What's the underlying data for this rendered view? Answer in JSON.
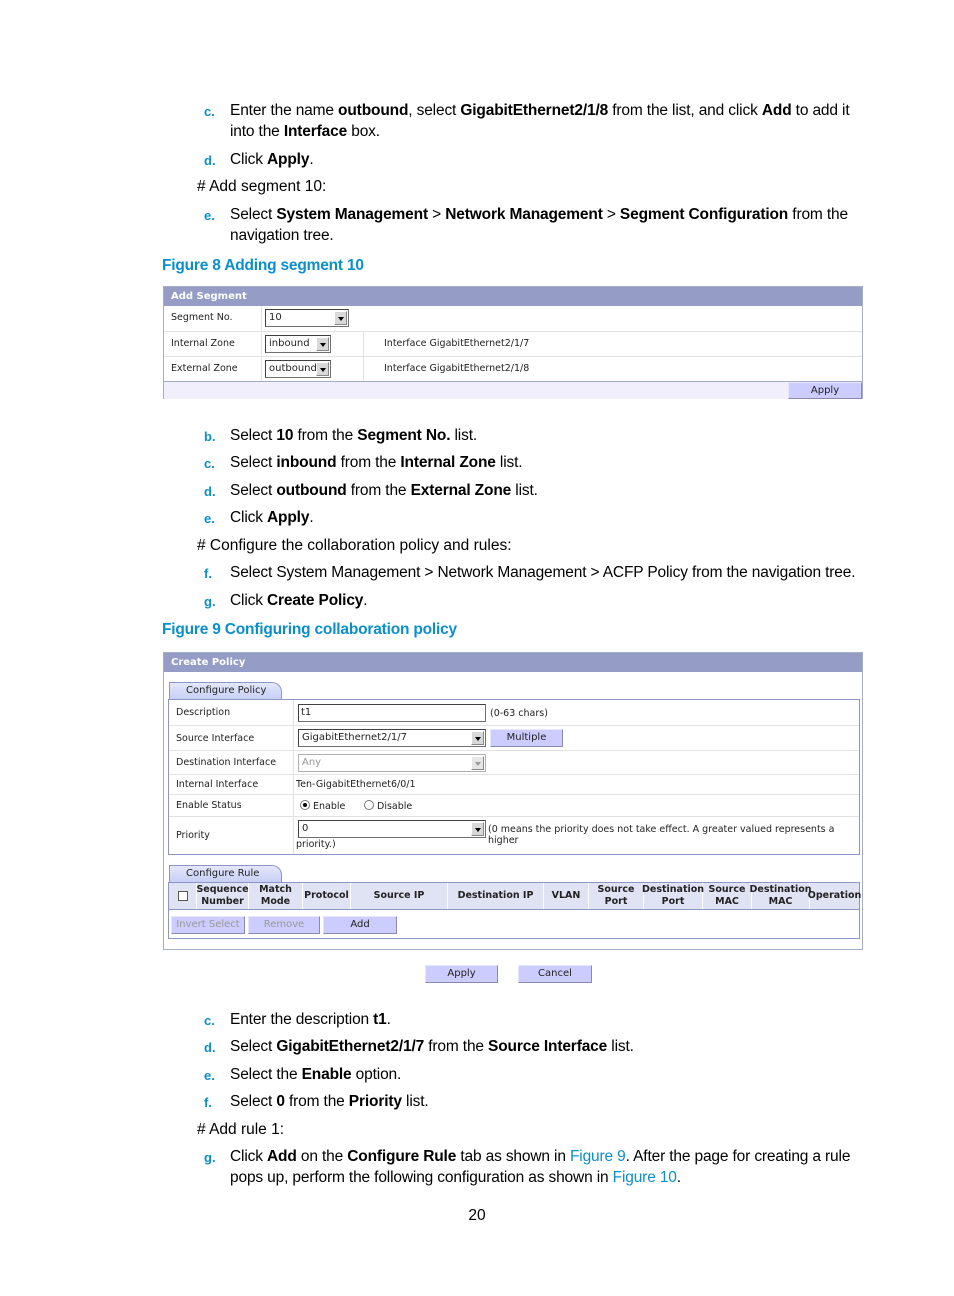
{
  "doc": {
    "step_c1": {
      "letter": "c.",
      "parts": [
        "Enter the name ",
        "outbound",
        ", select ",
        "GigabitEthernet2/1/8",
        " from the list, and click ",
        "Add",
        " to add it",
        "into the ",
        "Interface",
        " box."
      ]
    },
    "step_d1": {
      "letter": "d.",
      "parts": [
        "Click ",
        "Apply",
        "."
      ]
    },
    "note_segment": "# Add segment 10:",
    "step_e1": {
      "letter": "e.",
      "parts": [
        "Select ",
        "System Management",
        " > ",
        "Network Management",
        " > ",
        "Segment Configuration",
        " from the",
        "navigation tree."
      ]
    },
    "figure8_caption": "Figure 8 Adding segment 10",
    "step_b2": {
      "letter": "b.",
      "parts": [
        "Select ",
        "10",
        " from the ",
        "Segment No.",
        " list."
      ]
    },
    "step_c2": {
      "letter": "c.",
      "parts": [
        "Select ",
        "inbound",
        " from the ",
        "Internal Zone",
        " list."
      ]
    },
    "step_d2": {
      "letter": "d.",
      "parts": [
        "Select ",
        "outbound",
        " from the ",
        "External Zone",
        " list."
      ]
    },
    "step_e2": {
      "letter": "e.",
      "parts": [
        "Click ",
        "Apply",
        "."
      ]
    },
    "note_policy": "# Configure the collaboration policy and rules:",
    "step_f2": {
      "letter": "f.",
      "text": "Select System Management > Network Management > ACFP Policy from the navigation tree."
    },
    "step_g2": {
      "letter": "g.",
      "parts": [
        "Click ",
        "Create Policy",
        "."
      ]
    },
    "figure9_caption": "Figure 9 Configuring collaboration policy",
    "step_c3": {
      "letter": "c.",
      "parts": [
        "Enter the description ",
        "t1",
        "."
      ]
    },
    "step_d3": {
      "letter": "d.",
      "parts": [
        "Select ",
        "GigabitEthernet2/1/7",
        " from the ",
        "Source Interface",
        " list."
      ]
    },
    "step_e3": {
      "letter": "e.",
      "parts": [
        "Select the ",
        "Enable",
        " option."
      ]
    },
    "step_f3": {
      "letter": "f.",
      "parts": [
        "Select ",
        "0",
        " from the ",
        "Priority",
        " list."
      ]
    },
    "note_rule": "# Add rule 1:",
    "step_g3": {
      "letter": "g.",
      "parts": [
        "Click ",
        "Add",
        " on the ",
        "Configure Rule",
        " tab as shown in ",
        "Figure 9",
        ". After the page for creating a rule",
        "pops up, perform the following configuration as shown in ",
        "Figure 10",
        "."
      ]
    },
    "page_number": "20"
  },
  "add_segment": {
    "title": "Add Segment",
    "segment_no_label": "Segment No.",
    "segment_no_value": "10",
    "internal_zone_label": "Internal Zone",
    "internal_zone_value": "inbound",
    "internal_zone_interface": "Interface GigabitEthernet2/1/7",
    "external_zone_label": "External Zone",
    "external_zone_value": "outbound",
    "external_zone_interface": "Interface GigabitEthernet2/1/8",
    "apply_label": "Apply"
  },
  "create_policy": {
    "title": "Create Policy",
    "tab_policy": "Configure Policy",
    "description_label": "Description",
    "description_value": "t1",
    "description_hint": "(0-63  chars)",
    "source_interface_label": "Source Interface",
    "source_interface_value": "GigabitEthernet2/1/7",
    "multiple_label": "Multiple",
    "destination_interface_label": "Destination Interface",
    "destination_interface_value": "Any",
    "internal_interface_label": "Internal Interface",
    "internal_interface_value": "Ten-GigabitEthernet6/0/1",
    "enable_status_label": "Enable Status",
    "enable_option": "Enable",
    "disable_option": "Disable",
    "enable_selected": true,
    "priority_label": "Priority",
    "priority_value": "0",
    "priority_hint": "(0 means the priority does not take effect. A greater valued represents a higher",
    "priority_hint_cont": "priority.)",
    "tab_rule": "Configure Rule",
    "rule_columns": [
      "Sequence Number",
      "Match Mode",
      "Protocol",
      "Source IP",
      "Destination IP",
      "VLAN",
      "Source Port",
      "Destination Port",
      "Source MAC",
      "Destination MAC",
      "Operation"
    ],
    "invert_select_label": "Invert Select",
    "remove_label": "Remove",
    "add_label": "Add",
    "apply_label": "Apply",
    "cancel_label": "Cancel"
  },
  "colors": {
    "accent_blue": "#0a8fcc",
    "panel_header": "#959dc6",
    "button_fill": "#ccccfe"
  }
}
